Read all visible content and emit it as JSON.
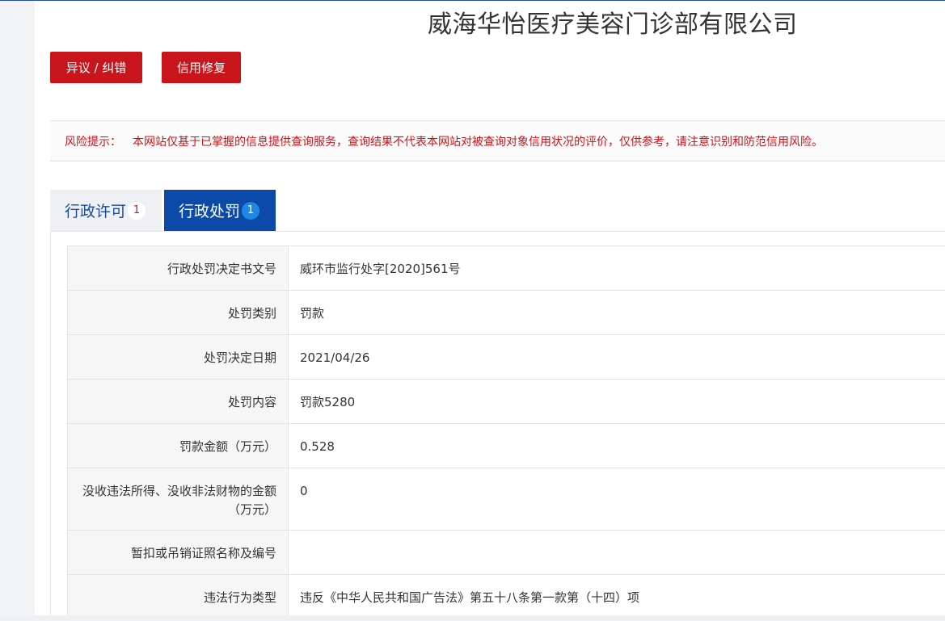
{
  "company": {
    "name": "威海华怡医疗美容门诊部有限公司"
  },
  "actions": {
    "objection_label": "异议 / 纠错",
    "credit_repair_label": "信用修复"
  },
  "risk_notice": {
    "label": "风险提示：",
    "text": "本网站仅基于已掌握的信息提供查询服务，查询结果不代表本网站对被查询对象信用状况的评价，仅供参考，请注意识别和防范信用风险。"
  },
  "tabs": [
    {
      "label": "行政许可",
      "count": "1",
      "active": false
    },
    {
      "label": "行政处罚",
      "count": "1",
      "active": true
    }
  ],
  "penalty_details": [
    {
      "key": "行政处罚决定书文号",
      "value": "威环市监行处字[2020]561号"
    },
    {
      "key": "处罚类别",
      "value": "罚款"
    },
    {
      "key": "处罚决定日期",
      "value": "2021/04/26"
    },
    {
      "key": "处罚内容",
      "value": "罚款5280"
    },
    {
      "key": "罚款金额（万元）",
      "value": "0.528"
    },
    {
      "key": "没收违法所得、没收非法财物的金额（万元）",
      "value": "0"
    },
    {
      "key": "暂扣或吊销证照名称及编号",
      "value": ""
    },
    {
      "key": "违法行为类型",
      "value": "违反《中华人民共和国广告法》第五十八条第一款第（十四）项"
    }
  ],
  "colors": {
    "brand_red": "#c8151b",
    "active_tab_blue": "#0b4aa8",
    "badge_blue": "#1e88e5",
    "inactive_tab_text": "#1a4a9e"
  }
}
